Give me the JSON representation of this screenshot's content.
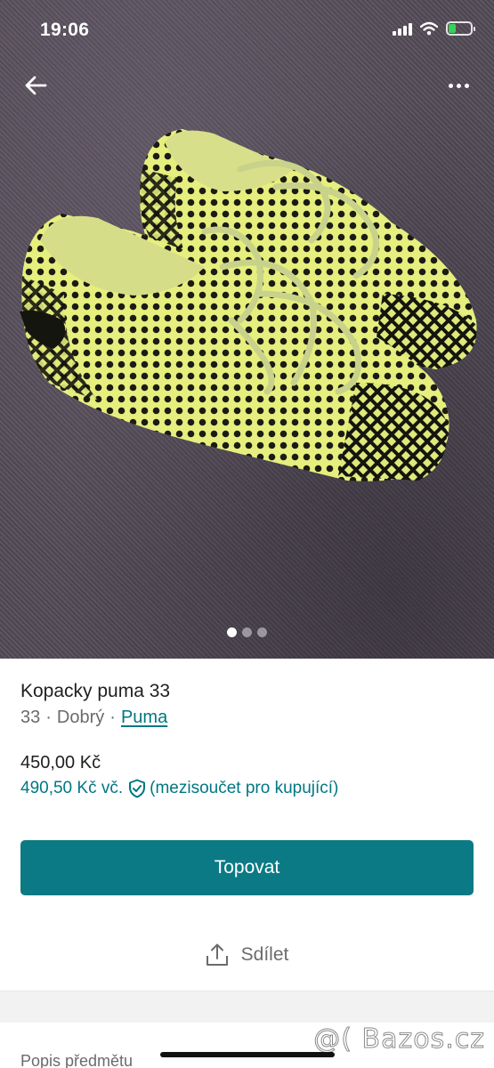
{
  "status_bar": {
    "time": "19:06"
  },
  "gallery": {
    "image_count": 3,
    "active_index": 0
  },
  "item": {
    "title": "Kopacky puma 33",
    "size": "33",
    "separator": "·",
    "condition": "Dobrý",
    "brand": "Puma"
  },
  "pricing": {
    "price": "450,00 Kč",
    "buyer_price": "490,50 Kč vč.",
    "buyer_note": "(mezisoučet pro kupující)"
  },
  "actions": {
    "promote_label": "Topovat",
    "share_label": "Sdílet"
  },
  "description": {
    "heading": "Popis předmětu"
  },
  "watermark": "@( Bazos.cz",
  "colors": {
    "accent": "#007782",
    "button": "#0b7a84"
  }
}
